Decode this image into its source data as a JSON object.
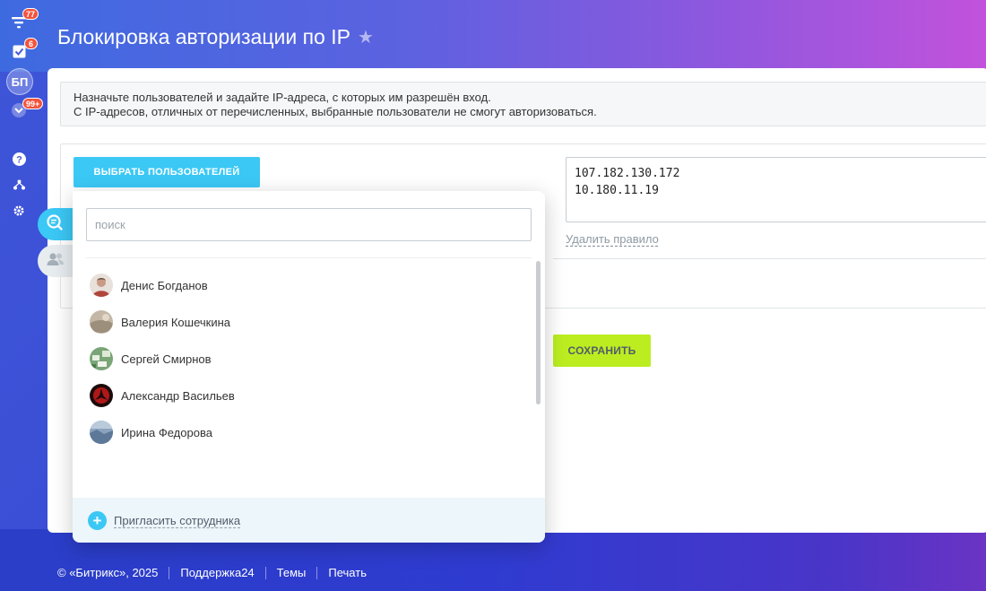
{
  "sidebar": {
    "badges": {
      "notifications": "77",
      "tasks": "6",
      "more": "99+"
    },
    "avatar_initials": "БП"
  },
  "page": {
    "title": "Блокировка авторизации по IP"
  },
  "info": {
    "line1": "Назначьте пользователей и задайте IP-адреса, с которых им разрешён вход.",
    "line2": "С IP-адресов, отличных от перечисленных, выбранные пользователи не смогут авторизоваться."
  },
  "rule": {
    "select_users_label": "ВЫБРАТЬ ПОЛЬЗОВАТЕЛЕЙ",
    "ip_addresses": "107.182.130.172\n10.180.11.19",
    "delete_rule_label": "Удалить правило"
  },
  "save_label": "СОХРАНИТЬ",
  "popup": {
    "search_placeholder": "поиск",
    "users": [
      {
        "name": "Денис Богданов"
      },
      {
        "name": "Валерия Кошечкина"
      },
      {
        "name": "Сергей Смирнов"
      },
      {
        "name": "Александр Васильев"
      },
      {
        "name": "Ирина Федорова"
      }
    ],
    "invite_label": "Пригласить сотрудника"
  },
  "footer": {
    "copyright": "© «Битрикс», 2025",
    "links": [
      "Поддержка24",
      "Темы",
      "Печать"
    ]
  },
  "colors": {
    "accent_blue": "#3bc8f5",
    "save_green": "#bbed21",
    "badge_red": "#f4533c"
  }
}
